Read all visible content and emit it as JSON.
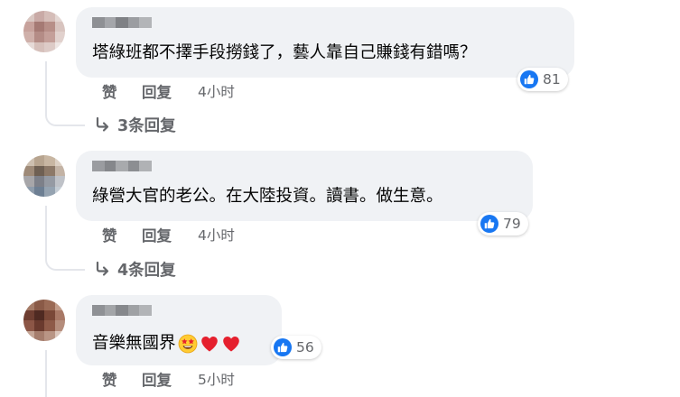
{
  "comments": [
    {
      "text": "塔綠班都不擇手段撈錢了，藝人靠自己賺錢有錯嗎？",
      "reaction_count": "81",
      "like_label": "赞",
      "reply_label": "回复",
      "time": "4小时",
      "replies_label": "3条回复"
    },
    {
      "text": "綠營大官的老公。在大陸投資。讀書。做生意。",
      "reaction_count": "79",
      "like_label": "赞",
      "reply_label": "回复",
      "time": "4小时",
      "replies_label": "4条回复"
    },
    {
      "text": "音樂無國界",
      "emojis": [
        "star-struck-emoji",
        "red-heart-emoji",
        "red-heart-emoji"
      ],
      "reaction_count": "56",
      "like_label": "赞",
      "reply_label": "回复",
      "time": "5小时"
    }
  ],
  "colors": {
    "bubble": "#f0f2f5",
    "like_blue": "#1877f2",
    "meta_gray": "#65676b",
    "text": "#050505"
  }
}
